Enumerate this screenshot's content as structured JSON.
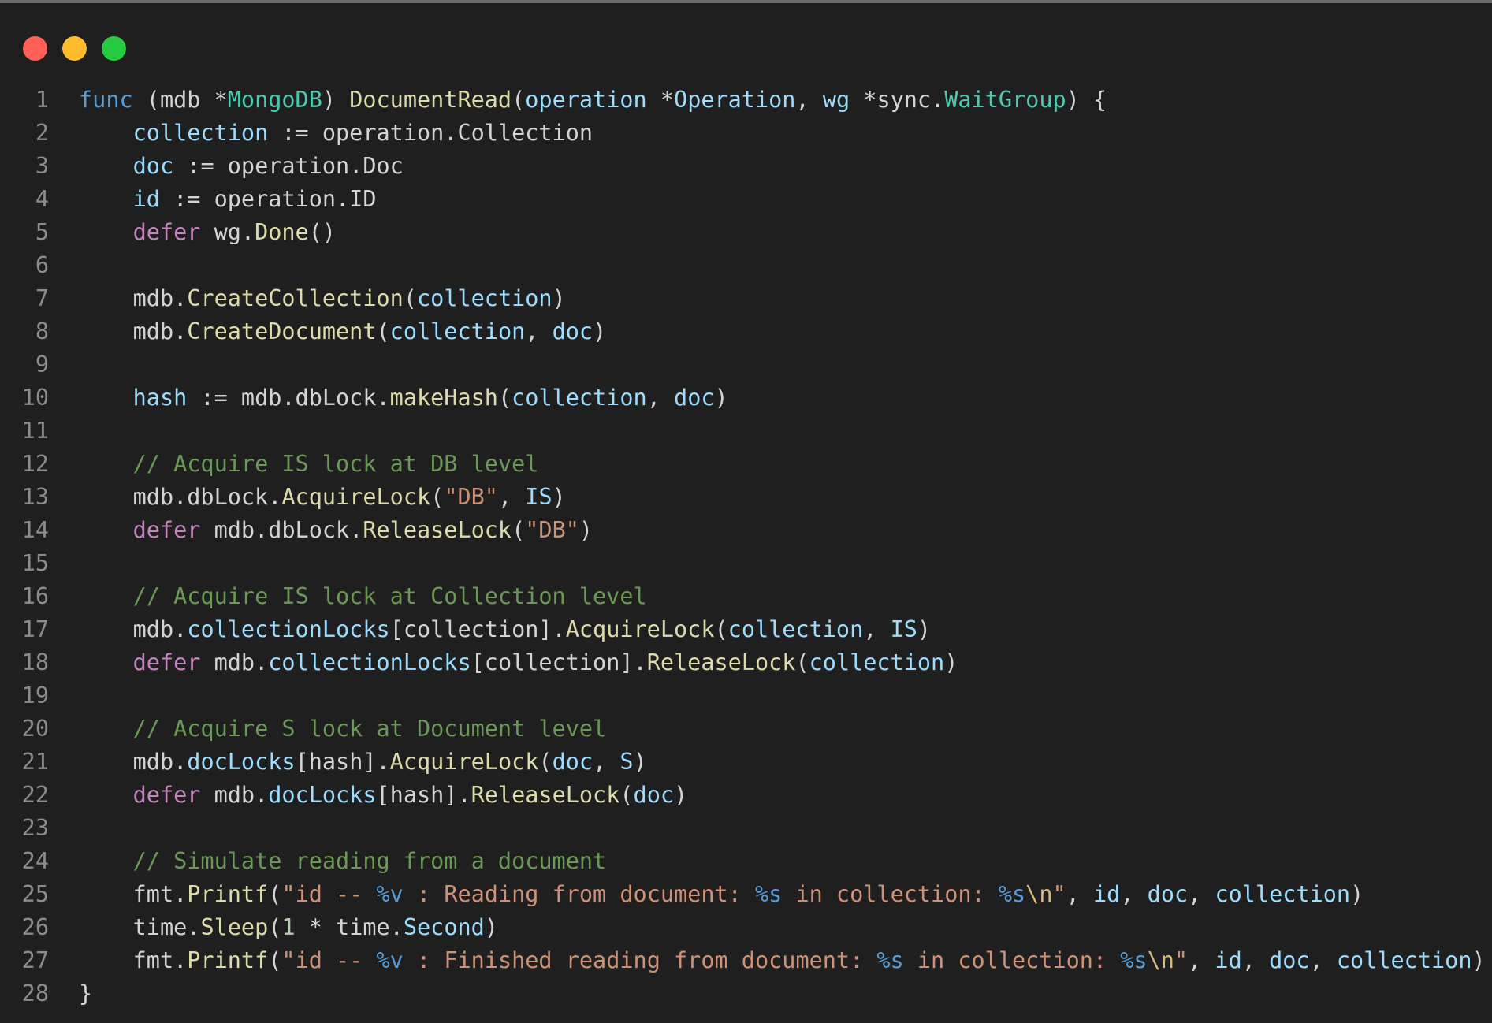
{
  "window": {
    "traffic_lights": [
      "close",
      "minimize",
      "maximize"
    ]
  },
  "colors": {
    "background": "#1f1f1f",
    "keyword": "#569cd6",
    "control_keyword": "#c586c0",
    "type": "#4ec9b0",
    "function": "#dcdcaa",
    "variable": "#9cdcfe",
    "string": "#ce9178",
    "escape": "#d7ba7d",
    "comment": "#6a9955",
    "number": "#b5cea8",
    "plain": "#d4d4d4",
    "line_number": "#8b8b8b"
  },
  "code": {
    "lines": [
      {
        "n": "1",
        "tokens": [
          [
            "k",
            "func"
          ],
          [
            "p",
            " (mdb *"
          ],
          [
            "t",
            "MongoDB"
          ],
          [
            "p",
            ") "
          ],
          [
            "f",
            "DocumentRead"
          ],
          [
            "p",
            "("
          ],
          [
            "v",
            "operation"
          ],
          [
            "p",
            " *"
          ],
          [
            "v",
            "Operation"
          ],
          [
            "p",
            ", "
          ],
          [
            "v",
            "wg"
          ],
          [
            "p",
            " *sync."
          ],
          [
            "t",
            "WaitGroup"
          ],
          [
            "p",
            ") {"
          ]
        ]
      },
      {
        "n": "2",
        "tokens": [
          [
            "p",
            "    "
          ],
          [
            "v",
            "collection"
          ],
          [
            "p",
            " := operation.Collection"
          ]
        ]
      },
      {
        "n": "3",
        "tokens": [
          [
            "p",
            "    "
          ],
          [
            "v",
            "doc"
          ],
          [
            "p",
            " := operation.Doc"
          ]
        ]
      },
      {
        "n": "4",
        "tokens": [
          [
            "p",
            "    "
          ],
          [
            "v",
            "id"
          ],
          [
            "p",
            " := operation.ID"
          ]
        ]
      },
      {
        "n": "5",
        "tokens": [
          [
            "p",
            "    "
          ],
          [
            "c",
            "defer"
          ],
          [
            "p",
            " wg."
          ],
          [
            "f",
            "Done"
          ],
          [
            "p",
            "()"
          ]
        ]
      },
      {
        "n": "6",
        "tokens": []
      },
      {
        "n": "7",
        "tokens": [
          [
            "p",
            "    mdb."
          ],
          [
            "f",
            "CreateCollection"
          ],
          [
            "p",
            "("
          ],
          [
            "v",
            "collection"
          ],
          [
            "p",
            ")"
          ]
        ]
      },
      {
        "n": "8",
        "tokens": [
          [
            "p",
            "    mdb."
          ],
          [
            "f",
            "CreateDocument"
          ],
          [
            "p",
            "("
          ],
          [
            "v",
            "collection"
          ],
          [
            "p",
            ", "
          ],
          [
            "v",
            "doc"
          ],
          [
            "p",
            ")"
          ]
        ]
      },
      {
        "n": "9",
        "tokens": []
      },
      {
        "n": "10",
        "tokens": [
          [
            "p",
            "    "
          ],
          [
            "v",
            "hash"
          ],
          [
            "p",
            " := mdb.dbLock."
          ],
          [
            "f",
            "makeHash"
          ],
          [
            "p",
            "("
          ],
          [
            "v",
            "collection"
          ],
          [
            "p",
            ", "
          ],
          [
            "v",
            "doc"
          ],
          [
            "p",
            ")"
          ]
        ]
      },
      {
        "n": "11",
        "tokens": []
      },
      {
        "n": "12",
        "tokens": [
          [
            "p",
            "    "
          ],
          [
            "cm",
            "// Acquire IS lock at DB level"
          ]
        ]
      },
      {
        "n": "13",
        "tokens": [
          [
            "p",
            "    mdb.dbLock."
          ],
          [
            "f",
            "AcquireLock"
          ],
          [
            "p",
            "("
          ],
          [
            "s",
            "\"DB\""
          ],
          [
            "p",
            ", "
          ],
          [
            "v",
            "IS"
          ],
          [
            "p",
            ")"
          ]
        ]
      },
      {
        "n": "14",
        "tokens": [
          [
            "p",
            "    "
          ],
          [
            "c",
            "defer"
          ],
          [
            "p",
            " mdb.dbLock."
          ],
          [
            "f",
            "ReleaseLock"
          ],
          [
            "p",
            "("
          ],
          [
            "s",
            "\"DB\""
          ],
          [
            "p",
            ")"
          ]
        ]
      },
      {
        "n": "15",
        "tokens": []
      },
      {
        "n": "16",
        "tokens": [
          [
            "p",
            "    "
          ],
          [
            "cm",
            "// Acquire IS lock at Collection level"
          ]
        ]
      },
      {
        "n": "17",
        "tokens": [
          [
            "p",
            "    mdb."
          ],
          [
            "v",
            "collectionLocks"
          ],
          [
            "p",
            "[collection]."
          ],
          [
            "f",
            "AcquireLock"
          ],
          [
            "p",
            "("
          ],
          [
            "v",
            "collection"
          ],
          [
            "p",
            ", "
          ],
          [
            "v",
            "IS"
          ],
          [
            "p",
            ")"
          ]
        ]
      },
      {
        "n": "18",
        "tokens": [
          [
            "p",
            "    "
          ],
          [
            "c",
            "defer"
          ],
          [
            "p",
            " mdb."
          ],
          [
            "v",
            "collectionLocks"
          ],
          [
            "p",
            "[collection]."
          ],
          [
            "f",
            "ReleaseLock"
          ],
          [
            "p",
            "("
          ],
          [
            "v",
            "collection"
          ],
          [
            "p",
            ")"
          ]
        ]
      },
      {
        "n": "19",
        "tokens": []
      },
      {
        "n": "20",
        "tokens": [
          [
            "p",
            "    "
          ],
          [
            "cm",
            "// Acquire S lock at Document level"
          ]
        ]
      },
      {
        "n": "21",
        "tokens": [
          [
            "p",
            "    mdb."
          ],
          [
            "v",
            "docLocks"
          ],
          [
            "p",
            "[hash]."
          ],
          [
            "f",
            "AcquireLock"
          ],
          [
            "p",
            "("
          ],
          [
            "v",
            "doc"
          ],
          [
            "p",
            ", "
          ],
          [
            "v",
            "S"
          ],
          [
            "p",
            ")"
          ]
        ]
      },
      {
        "n": "22",
        "tokens": [
          [
            "p",
            "    "
          ],
          [
            "c",
            "defer"
          ],
          [
            "p",
            " mdb."
          ],
          [
            "v",
            "docLocks"
          ],
          [
            "p",
            "[hash]."
          ],
          [
            "f",
            "ReleaseLock"
          ],
          [
            "p",
            "("
          ],
          [
            "v",
            "doc"
          ],
          [
            "p",
            ")"
          ]
        ]
      },
      {
        "n": "23",
        "tokens": []
      },
      {
        "n": "24",
        "tokens": [
          [
            "p",
            "    "
          ],
          [
            "cm",
            "// Simulate reading from a document"
          ]
        ]
      },
      {
        "n": "25",
        "tokens": [
          [
            "p",
            "    fmt."
          ],
          [
            "f",
            "Printf"
          ],
          [
            "p",
            "("
          ],
          [
            "s",
            "\"id -- "
          ],
          [
            "k",
            "%v"
          ],
          [
            "s",
            " : Reading from document: "
          ],
          [
            "k",
            "%s"
          ],
          [
            "s",
            " in collection: "
          ],
          [
            "k",
            "%s"
          ],
          [
            "e",
            "\\n"
          ],
          [
            "s",
            "\""
          ],
          [
            "p",
            ", "
          ],
          [
            "v",
            "id"
          ],
          [
            "p",
            ", "
          ],
          [
            "v",
            "doc"
          ],
          [
            "p",
            ", "
          ],
          [
            "v",
            "collection"
          ],
          [
            "p",
            ")"
          ]
        ]
      },
      {
        "n": "26",
        "tokens": [
          [
            "p",
            "    time."
          ],
          [
            "f",
            "Sleep"
          ],
          [
            "p",
            "("
          ],
          [
            "n",
            "1"
          ],
          [
            "p",
            " * time."
          ],
          [
            "v",
            "Second"
          ],
          [
            "p",
            ")"
          ]
        ]
      },
      {
        "n": "27",
        "tokens": [
          [
            "p",
            "    fmt."
          ],
          [
            "f",
            "Printf"
          ],
          [
            "p",
            "("
          ],
          [
            "s",
            "\"id -- "
          ],
          [
            "k",
            "%v"
          ],
          [
            "s",
            " : Finished reading from document: "
          ],
          [
            "k",
            "%s"
          ],
          [
            "s",
            " in collection: "
          ],
          [
            "k",
            "%s"
          ],
          [
            "e",
            "\\n"
          ],
          [
            "s",
            "\""
          ],
          [
            "p",
            ", "
          ],
          [
            "v",
            "id"
          ],
          [
            "p",
            ", "
          ],
          [
            "v",
            "doc"
          ],
          [
            "p",
            ", "
          ],
          [
            "v",
            "collection"
          ],
          [
            "p",
            ")"
          ]
        ]
      },
      {
        "n": "28",
        "tokens": [
          [
            "p",
            "}"
          ]
        ]
      }
    ]
  }
}
